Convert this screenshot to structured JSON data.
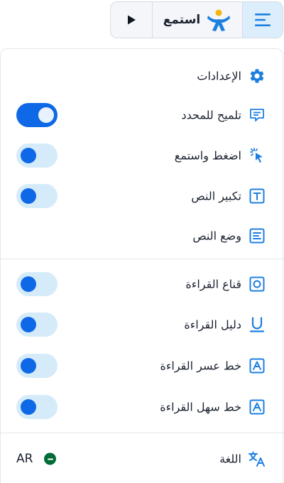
{
  "toolbar": {
    "listen_label": "استمع"
  },
  "menu": {
    "settings_label": "الإعدادات",
    "items": [
      {
        "label": "تلميح للمحدد",
        "toggle_on": true
      },
      {
        "label": "اضغط واستمع",
        "toggle_on": false
      },
      {
        "label": "تكبير النص",
        "toggle_on": false
      },
      {
        "label": "وضع النص"
      },
      {
        "label": "قناع القراءة",
        "toggle_on": false
      },
      {
        "label": "دليل القراءة",
        "toggle_on": false
      },
      {
        "label": "خط عسر القراءة",
        "toggle_on": false
      },
      {
        "label": "خط سهل القراءة",
        "toggle_on": false
      }
    ],
    "language_label": "اللغة",
    "language_code": "AR"
  },
  "colors": {
    "accent": "#0f69e6",
    "toggle_track_off": "#d6ebfa",
    "toolbar_bg": "#f4f6f9",
    "menu_button_bg": "#dcedfb"
  },
  "icons": [
    "play-icon",
    "listen-logo-icon",
    "menu-icon",
    "gear-icon",
    "tooltip-icon",
    "click-icon",
    "text-size-icon",
    "text-mode-icon",
    "reading-mask-icon",
    "reading-guide-icon",
    "dyslexia-font-icon",
    "readable-font-icon",
    "translate-icon",
    "saudi-flag-icon"
  ]
}
